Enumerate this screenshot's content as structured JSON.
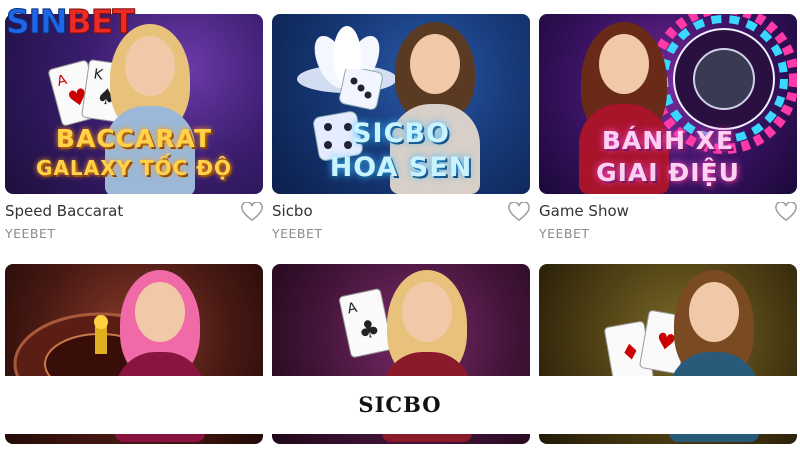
{
  "brand": {
    "logo_part1": "SIN",
    "logo_part2": "BET"
  },
  "games": [
    {
      "name": "Speed Baccarat",
      "provider": "YEEBET",
      "art_line1": "BACCARAT",
      "art_line2": "GALAXY TỐC ĐỘ",
      "favorite_icon": "heart-outline-icon"
    },
    {
      "name": "Sicbo",
      "provider": "YEEBET",
      "art_line1": "SICBO",
      "art_line2": "HOA SEN",
      "favorite_icon": "heart-outline-icon"
    },
    {
      "name": "Game Show",
      "provider": "YEEBET",
      "art_line1": "BÁNH XE",
      "art_line2": "GIAI ĐIỆU",
      "favorite_icon": "heart-outline-icon"
    },
    {
      "name": "",
      "provider": ""
    },
    {
      "name": "",
      "provider": ""
    },
    {
      "name": "",
      "provider": ""
    }
  ],
  "caption": "SICBO",
  "colors": {
    "logo_blue": "#1e66e8",
    "logo_red": "#ee2a24",
    "name_text": "#333333",
    "provider_text": "#8c8c8c"
  }
}
